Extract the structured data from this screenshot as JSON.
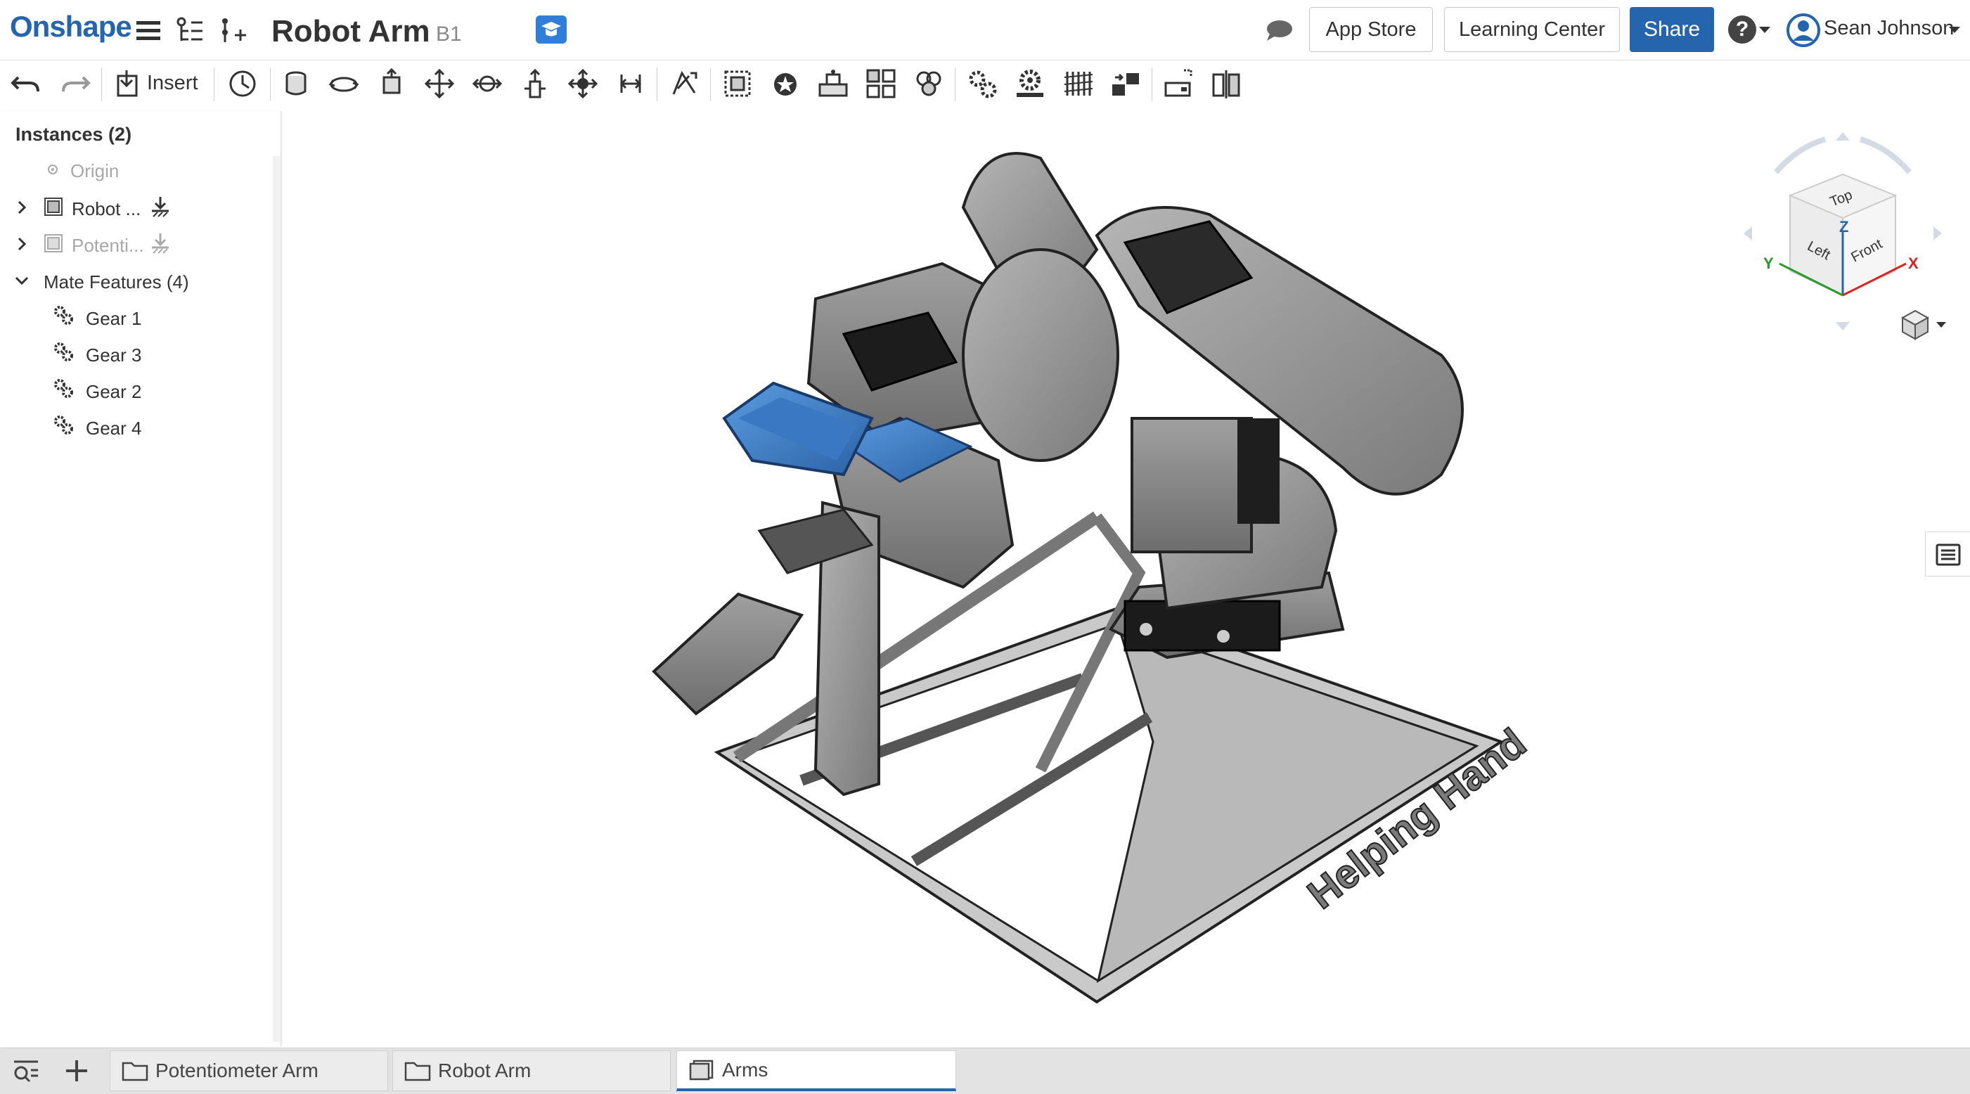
{
  "app": {
    "name": "Onshape"
  },
  "document": {
    "title": "Robot Arm",
    "version": "B1"
  },
  "header": {
    "app_store": "App Store",
    "learning_center": "Learning Center",
    "share": "Share",
    "help": "?",
    "user": "Sean Johnson"
  },
  "toolbar": {
    "insert": "Insert"
  },
  "panel": {
    "instances_header": "Instances (2)",
    "origin": "Origin",
    "items": [
      {
        "label": "Robot ...",
        "icon": "part-studio-icon",
        "state": "fixed"
      },
      {
        "label": "Potenti...",
        "icon": "part-studio-icon",
        "state": "suppressed"
      }
    ],
    "mate_features_header": "Mate Features (4)",
    "mate_features": [
      {
        "label": "Gear 1",
        "icon": "gear-relation-icon"
      },
      {
        "label": "Gear 3",
        "icon": "gear-relation-icon"
      },
      {
        "label": "Gear 2",
        "icon": "gear-relation-icon"
      },
      {
        "label": "Gear 4",
        "icon": "gear-relation-icon"
      }
    ]
  },
  "viewcube": {
    "top": "Top",
    "left": "Left",
    "front": "Front",
    "x": "X",
    "y": "Y",
    "z": "Z"
  },
  "model": {
    "base_text": "Helping Hand"
  },
  "tabs": [
    {
      "label": "Potentiometer Arm",
      "icon": "folder-icon",
      "active": false
    },
    {
      "label": "Robot Arm",
      "icon": "folder-icon",
      "active": false
    },
    {
      "label": "Arms",
      "icon": "assembly-icon",
      "active": true
    }
  ],
  "colors": {
    "brand": "#2465ae",
    "highlight_part": "#3d7ec6",
    "model_gray": "#8e8e8e"
  }
}
